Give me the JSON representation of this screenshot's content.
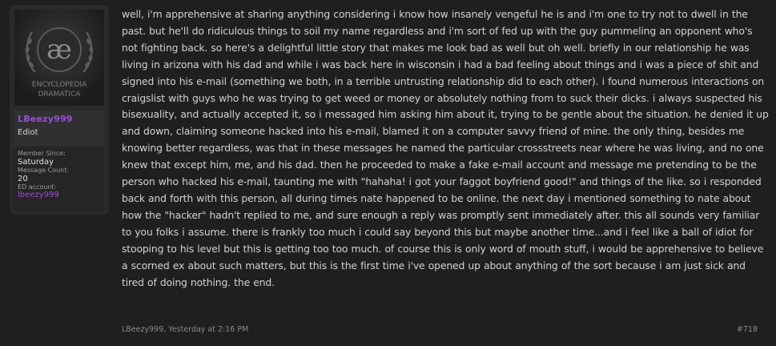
{
  "user": {
    "logo_glyph": "æ",
    "logo_line1": "ENCYCLOPEDIA",
    "logo_line2": "DRAMATICA",
    "username": "LBeezy999",
    "title": "Ediot",
    "member_since_label": "Member Since:",
    "member_since": "Saturday",
    "message_count_label": "Message Count:",
    "message_count": "20",
    "ed_account_label": "ED account:",
    "ed_account": "lbeezy999"
  },
  "post": {
    "body": "well, i'm apprehensive at sharing anything considering i know how insanely vengeful he is and i'm one to try not to dwell in the past. but he'll do ridiculous things to soil my name regardless and i'm sort of fed up with the guy pummeling an opponent who's not fighting back. so here's a delightful little story that makes me look bad as well but oh well. briefly in our relationship he was living in arizona with his dad and while i was back here in wisconsin i had a bad feeling about things and i was a piece of shit and signed into his e-mail (something we both, in a terrible untrusting relationship did to each other). i found numerous interactions on craigslist with guys who he was trying to get weed or money or absolutely nothing from to suck their dicks. i always suspected his bisexuality, and actually accepted it, so i messaged him asking him about it, trying to be gentle about the situation. he denied it up and down, claiming someone hacked into his e-mail, blamed it on a computer savvy friend of mine. the only thing, besides me knowing better regardless, was that in these messages he named the particular crossstreets near where he was living, and no one knew that except him, me, and his dad. then he proceeded to make a fake e-mail account and message me pretending to be the person who hacked his e-mail, taunting me with \"hahaha! i got your faggot boyfriend good!\" and things of the like. so i responded back and forth with this person, all during times nate happened to be online. the next day i mentioned something to nate about how the \"hacker\" hadn't replied to me, and sure enough a reply was promptly sent immediately after. this all sounds very familiar to you folks i assume. there is frankly too much i could say beyond this but maybe another time...and i feel like a ball of idiot for stooping to his level but this is getting too too much. of course this is only word of mouth stuff, i would be apprehensive to believe a scorned ex about such matters, but this is the first time i've opened up about anything of the sort because i am just sick and tired of doing nothing. the end.",
    "author": "LBeezy999",
    "separator": ", ",
    "date": "Yesterday at 2:16 PM",
    "number": "#718"
  }
}
